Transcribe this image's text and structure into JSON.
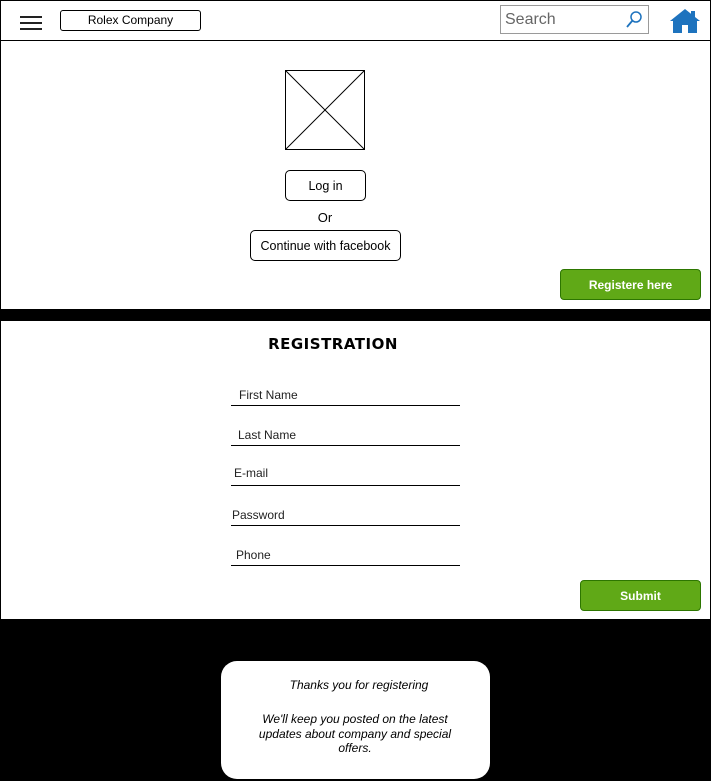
{
  "header": {
    "brand": "Rolex Company",
    "search_placeholder": "Search"
  },
  "auth": {
    "login_label": "Log in",
    "or_text": "Or",
    "facebook_label": "Continue with facebook",
    "register_label": "Registere here"
  },
  "registration": {
    "title": "REGISTRATION",
    "fields": {
      "first_name": "First Name",
      "last_name": "Last Name",
      "email": "E-mail",
      "password": "Password",
      "phone": "Phone"
    },
    "submit_label": "Submit"
  },
  "thanks": {
    "line1": "Thanks you for registering",
    "line2": "We'll keep you posted on the latest updates about company and special offers."
  },
  "colors": {
    "accent_green": "#60a917",
    "home_icon": "#1e73be"
  }
}
